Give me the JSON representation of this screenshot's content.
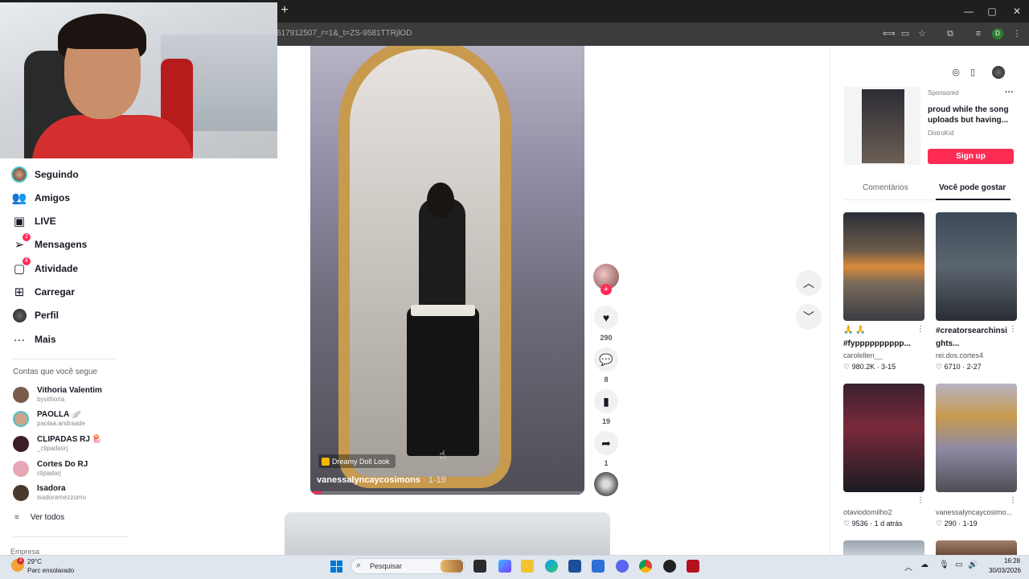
{
  "browser": {
    "url": "617912507_r=1&_t=ZS-9581TTRjlOD",
    "new_tab_symbol": "+",
    "window_controls": [
      "—",
      "▢",
      "✕"
    ],
    "profile_initial": "D"
  },
  "sidebar": {
    "nav": [
      {
        "label": "Seguindo",
        "icon": "following-avatar-icon"
      },
      {
        "label": "Amigos",
        "icon": "friends-icon"
      },
      {
        "label": "LIVE",
        "icon": "live-icon"
      },
      {
        "label": "Mensagens",
        "icon": "messages-icon",
        "badge": "2"
      },
      {
        "label": "Atividade",
        "icon": "activity-icon",
        "badge": "4"
      },
      {
        "label": "Carregar",
        "icon": "upload-icon"
      },
      {
        "label": "Perfil",
        "icon": "profile-avatar-icon"
      },
      {
        "label": "Mais",
        "icon": "more-icon"
      }
    ],
    "following_heading": "Contas que você segue",
    "following": [
      {
        "name": "Vithoria Valentim",
        "handle": "byvithoria",
        "color": "#7a5a4a"
      },
      {
        "name": "PAOLLA 🪽",
        "handle": "paolaa.andraade",
        "color": "#c9a38a"
      },
      {
        "name": "CLIPADAS RJ 🪼",
        "handle": "_clipadasrj",
        "color": "#3a1f2a"
      },
      {
        "name": "Cortes Do RJ",
        "handle": "clipadarj",
        "color": "#e7a6b3"
      },
      {
        "name": "Isadora",
        "handle": "isadoramezzomo",
        "color": "#4a3a2e"
      }
    ],
    "see_all": "Ver todos",
    "company": "Empresa"
  },
  "video": {
    "tag": "Dreamy Doll Look",
    "author": "vanessalyncaycosimons",
    "date": "1-19",
    "progress": 0.04
  },
  "actions": {
    "likes": "290",
    "comments": "8",
    "saves": "19",
    "shares": "1"
  },
  "ad": {
    "sponsored": "Sponsored",
    "title": "proud while the song uploads but having...",
    "brand": "DistroKid",
    "cta": "Sign up"
  },
  "right_tabs": [
    "Comentários",
    "Você pode gostar"
  ],
  "suggested": [
    {
      "caption": "🙏 🙏",
      "caption2": "#fypppppppppp...",
      "author": "carolellen__",
      "likes": "980.2K",
      "date": "3-15"
    },
    {
      "caption": "#creatorsearchinsi",
      "caption2": "ghts...",
      "author": "rei.dos.cortes4",
      "likes": "6710",
      "date": "2-27"
    },
    {
      "author": "otaviodomilho2",
      "likes": "9536",
      "date": "1 d atrás"
    },
    {
      "author": "vanessalyncaycosimo...",
      "likes": "290",
      "date": "1-19"
    }
  ],
  "taskbar": {
    "weather_temp": "29°C",
    "weather_desc": "Parc ensolarado",
    "weather_badge": "3",
    "search_placeholder": "Pesquisar",
    "time": "16:28",
    "date": "30/03/2026"
  },
  "colors": {
    "accent": "#fe2c55",
    "chrome_dark": "#1f1f1f",
    "taskbar": "#dfe6ee"
  }
}
